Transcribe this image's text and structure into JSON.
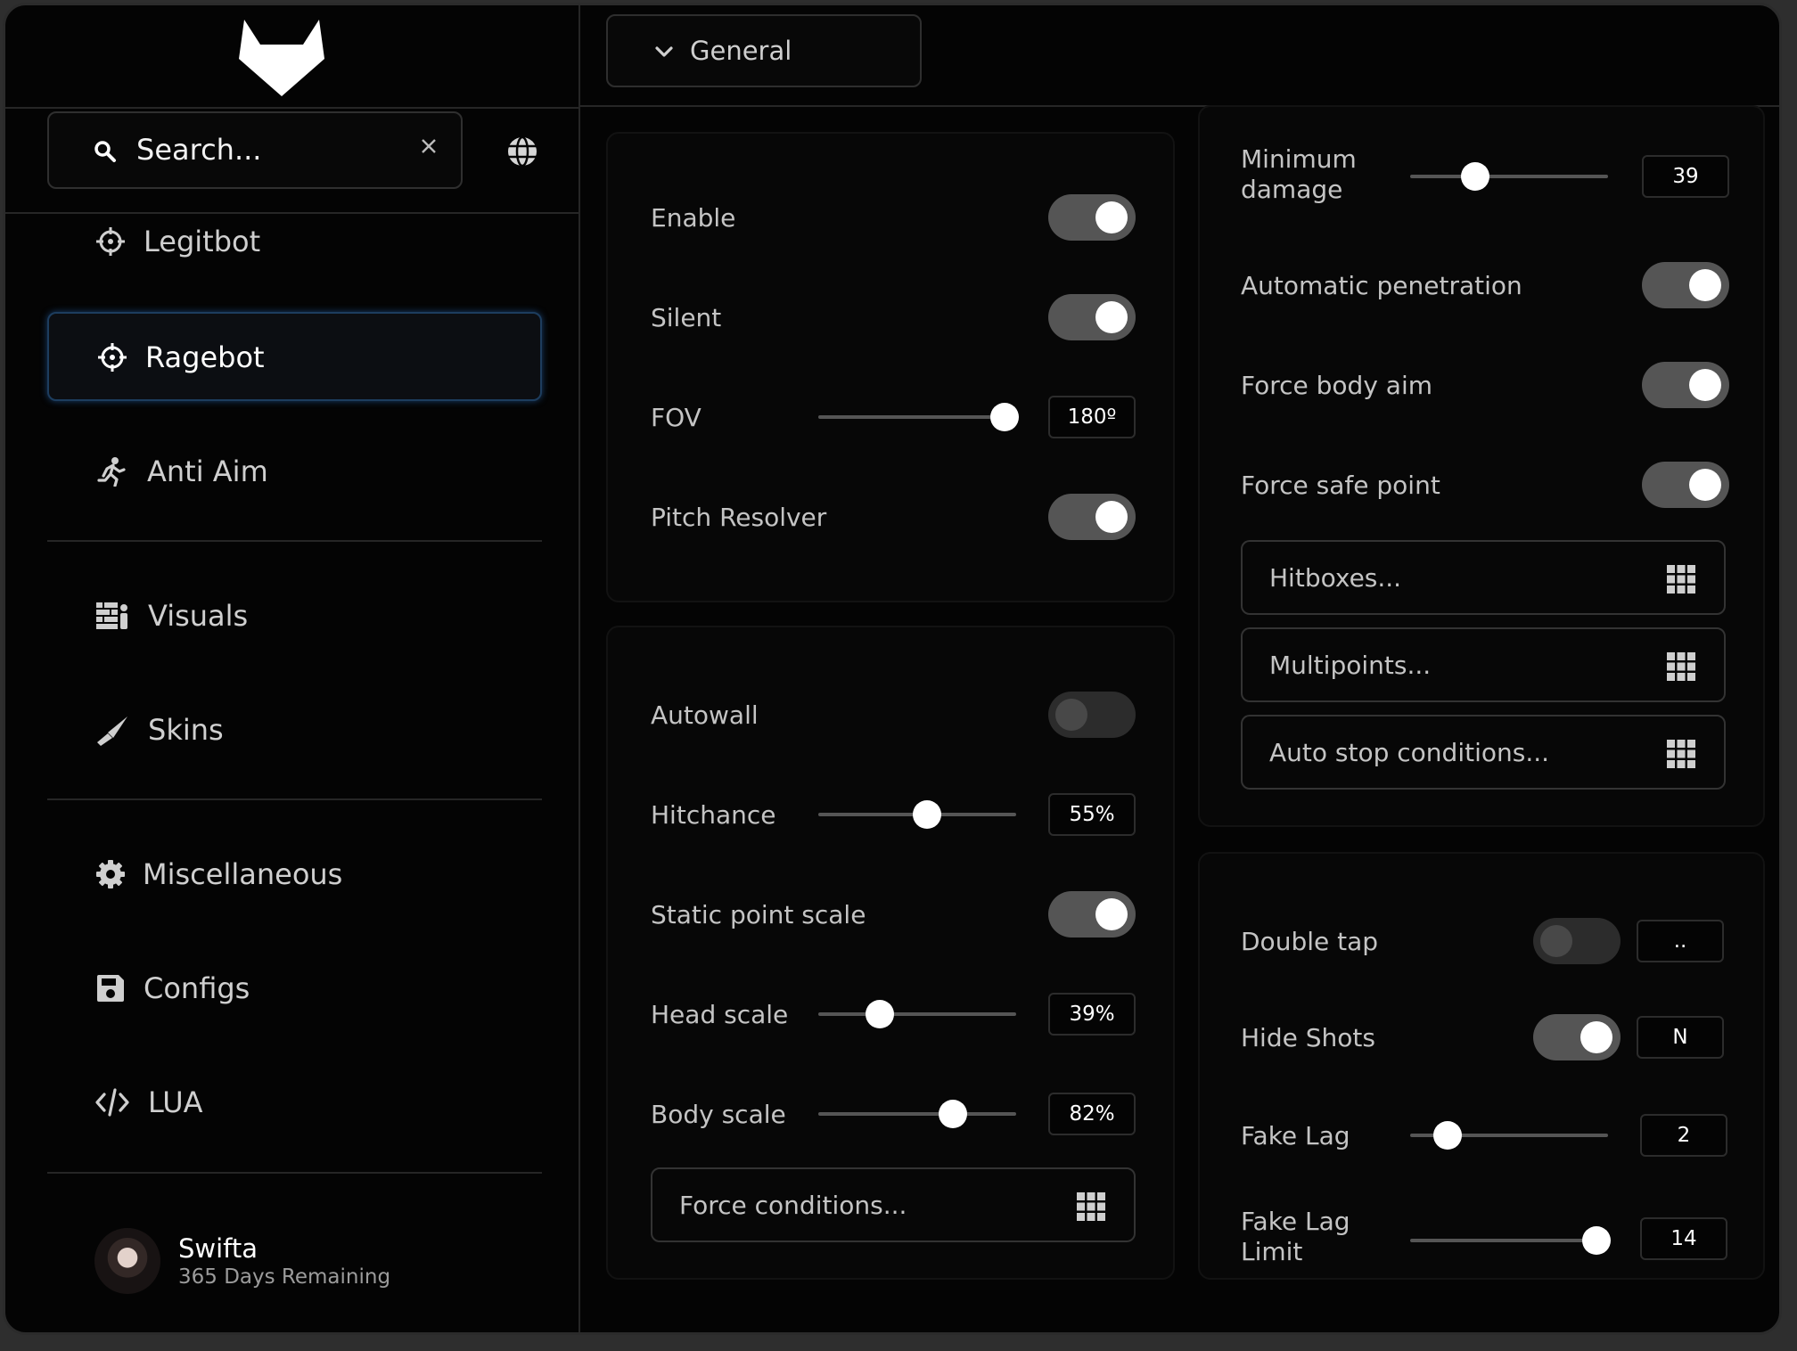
{
  "sidebar": {
    "search_placeholder": "Search...",
    "items": [
      {
        "label": "Legitbot",
        "icon": "crosshair-icon",
        "active": false
      },
      {
        "label": "Ragebot",
        "icon": "crosshair-icon",
        "active": true
      },
      {
        "label": "Anti Aim",
        "icon": "running-person-icon",
        "active": false
      },
      {
        "label": "Visuals",
        "icon": "visuals-icon",
        "active": false
      },
      {
        "label": "Skins",
        "icon": "knife-icon",
        "active": false
      },
      {
        "label": "Miscellaneous",
        "icon": "gear-icon",
        "active": false
      },
      {
        "label": "Configs",
        "icon": "save-icon",
        "active": false
      },
      {
        "label": "LUA",
        "icon": "code-icon",
        "active": false
      }
    ],
    "user": {
      "name": "Swifta",
      "subscription": "365 Days Remaining"
    }
  },
  "header": {
    "dropdown_label": "General"
  },
  "panel_general": {
    "enable": {
      "label": "Enable",
      "on": true
    },
    "silent": {
      "label": "Silent",
      "on": true
    },
    "fov": {
      "label": "FOV",
      "value": "180º",
      "fraction": 0.94
    },
    "pitch_resolver": {
      "label": "Pitch Resolver",
      "on": true
    }
  },
  "panel_accuracy": {
    "autowall": {
      "label": "Autowall",
      "on": false
    },
    "hitchance": {
      "label": "Hitchance",
      "value": "55%",
      "fraction": 0.55
    },
    "static_point_scale": {
      "label": "Static point scale",
      "on": true
    },
    "head_scale": {
      "label": "Head scale",
      "value": "39%",
      "fraction": 0.31
    },
    "body_scale": {
      "label": "Body scale",
      "value": "82%",
      "fraction": 0.68
    },
    "force_conditions": {
      "label": "Force conditions..."
    }
  },
  "panel_targeting": {
    "minimum_damage": {
      "label_line1": "Minimum",
      "label_line2": "damage",
      "value": "39",
      "fraction": 0.33
    },
    "automatic_penetration": {
      "label": "Automatic penetration",
      "on": true
    },
    "force_body_aim": {
      "label": "Force body aim",
      "on": true
    },
    "force_safe_point": {
      "label": "Force safe point",
      "on": true
    },
    "hitboxes": {
      "label": "Hitboxes..."
    },
    "multipoints": {
      "label": "Multipoints..."
    },
    "auto_stop": {
      "label": "Auto stop conditions..."
    }
  },
  "panel_exploits": {
    "double_tap": {
      "label": "Double tap",
      "on": false,
      "key": ".."
    },
    "hide_shots": {
      "label": "Hide Shots",
      "on": true,
      "key": "N"
    },
    "fake_lag": {
      "label": "Fake Lag",
      "value": "2",
      "fraction": 0.19
    },
    "fake_lag_limit": {
      "label_line1": "Fake Lag",
      "label_line2": "Limit",
      "value": "14",
      "fraction": 0.94
    }
  },
  "colors": {
    "window_bg": "#040404",
    "panel_bg": "#070707",
    "active_border": "#1d3d5e",
    "toggle_on": "#555555",
    "toggle_off": "#2c2c2c"
  }
}
